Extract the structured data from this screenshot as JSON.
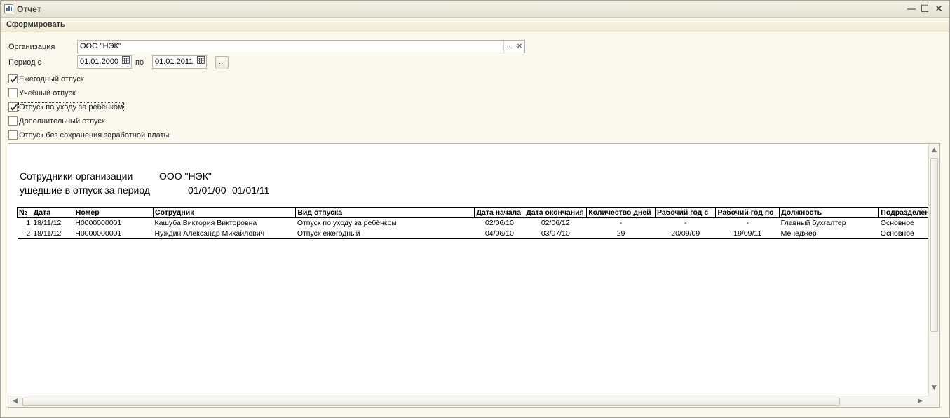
{
  "window": {
    "title": "Отчет",
    "minimize_glyph": "—",
    "maximize_glyph": "☐",
    "close_glyph": "✕"
  },
  "toolbar": {
    "generate_label": "Сформировать"
  },
  "form": {
    "organization_label": "Организация",
    "organization_value": "ООО \"НЭК\"",
    "select_glyph": "...",
    "clear_glyph": "✕",
    "period_label": "Период с",
    "period_from": "01.01.2000",
    "period_to_label": "по",
    "period_to": "01.01.2011",
    "period_button_label": "..."
  },
  "checkboxes": [
    {
      "label": "Ежегодный отпуск",
      "checked": true
    },
    {
      "label": "Учебный отпуск",
      "checked": false
    },
    {
      "label": "Отпуск по уходу за ребёнком",
      "checked": true
    },
    {
      "label": "Дополнительный отпуск",
      "checked": false
    },
    {
      "label": "Отпуск без сохранения заработной платы",
      "checked": false
    }
  ],
  "report": {
    "header_line1_label": "Сотрудники организации",
    "header_line1_value": "ООО \"НЭК\"",
    "header_line2_label": "ушедшие в отпуск за период",
    "period_start": "01/01/00",
    "period_end": "01/01/11",
    "columns": [
      "№",
      "Дата",
      "Номер",
      "Сотрудник",
      "Вид отпуска",
      "Дата начала",
      "Дата окончания",
      "Количество дней",
      "Рабочий год с",
      "Рабочий год по",
      "Должность",
      "Подразделение"
    ],
    "rows": [
      [
        "1",
        "18/11/12",
        "Н0000000001",
        "Кашуба Виктория Викторовна",
        "Отпуск по уходу за ребёнком",
        "02/06/10",
        "02/06/12",
        "-",
        "-",
        "-",
        "Главный бухгалтер",
        "Основное"
      ],
      [
        "2",
        "18/11/12",
        "Н0000000001",
        "Нуждин Александр Михайлович",
        "Отпуск ежегодный",
        "04/06/10",
        "03/07/10",
        "29",
        "20/09/09",
        "19/09/11",
        "Менеджер",
        "Основное"
      ]
    ]
  },
  "scrollbars": {
    "up": "▲",
    "down": "▼",
    "left": "◀",
    "right": "▶"
  }
}
